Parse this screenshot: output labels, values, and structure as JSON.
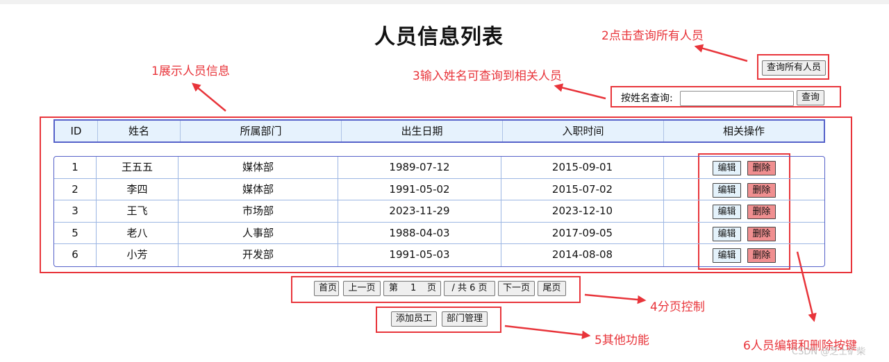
{
  "title": "人员信息列表",
  "annotations": {
    "a1": "1展示人员信息",
    "a2": "2点击查询所有人员",
    "a3": "3输入姓名可查询到相关人员",
    "a4": "4分页控制",
    "a5": "5其他功能",
    "a6": "6人员编辑和删除按键"
  },
  "query_all_label": "查询所有人员",
  "search": {
    "label": "按姓名查询:",
    "value": "",
    "button": "查询"
  },
  "table": {
    "headers": [
      "ID",
      "姓名",
      "所属部门",
      "出生日期",
      "入职时间",
      "相关操作"
    ],
    "rows": [
      [
        "1",
        "王五五",
        "媒体部",
        "1989-07-12",
        "2015-09-01"
      ],
      [
        "2",
        "李四",
        "媒体部",
        "1991-05-02",
        "2015-07-02"
      ],
      [
        "3",
        "王飞",
        "市场部",
        "2023-11-29",
        "2023-12-10"
      ],
      [
        "5",
        "老八",
        "人事部",
        "1988-04-03",
        "2017-09-05"
      ],
      [
        "6",
        "小芳",
        "开发部",
        "1991-05-03",
        "2014-08-08"
      ]
    ],
    "edit_label": "编辑",
    "delete_label": "删除"
  },
  "pager": {
    "first": "首页",
    "prev": "上一页",
    "page_prefix": "第",
    "page_current": "1",
    "page_suffix": "页",
    "total_text": "/ 共 6 页",
    "next": "下一页",
    "last": "尾页"
  },
  "actions": {
    "add_employee": "添加员工",
    "dept_manage": "部门管理"
  },
  "watermark": "CSDN @芝士矿柴",
  "colors": {
    "annotation": "#e8343a",
    "table_border": "#5561c9",
    "header_bg": "#e6f2fd",
    "delete_bg": "#f08f90",
    "edit_bg": "#e4f2fb"
  }
}
